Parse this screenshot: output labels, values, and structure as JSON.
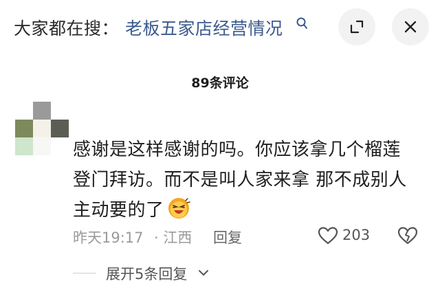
{
  "search": {
    "prefix": "大家都在搜：",
    "query": "老板五家店经营情况",
    "icon": "search-icon"
  },
  "header_buttons": [
    {
      "icon": "collapse-icon"
    },
    {
      "icon": "close-icon"
    }
  ],
  "comments": {
    "count_label": "89条评论"
  },
  "comment": {
    "lines": [
      "感谢是这样感谢的吗。你应该拿几个榴莲",
      "登门拜访。而不是叫人家来拿 那不成别人",
      "主动要的了"
    ],
    "emoji": "laughing-emoji",
    "time": "昨天19:17",
    "location": "· 江西",
    "reply_label": "回复",
    "like_count": "203",
    "expand_label": "展开5条回复"
  },
  "colors": {
    "query": "#3a5a8c",
    "meta": "#9a9a9a",
    "button_bg": "#f2f2f2"
  }
}
